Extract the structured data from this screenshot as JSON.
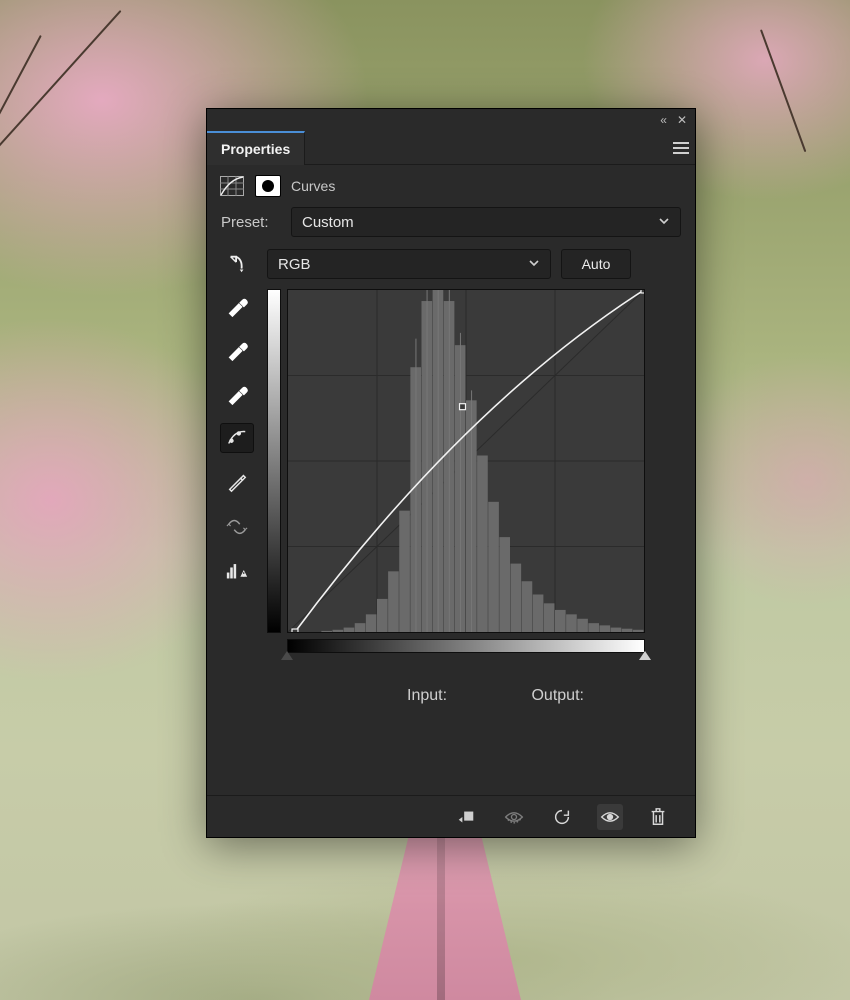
{
  "panel": {
    "title": "Properties",
    "adjustment_type": "Curves"
  },
  "preset": {
    "label": "Preset:",
    "value": "Custom"
  },
  "channel": {
    "value": "RGB",
    "auto_label": "Auto"
  },
  "io": {
    "input_label": "Input:",
    "output_label": "Output:",
    "input_value": "",
    "output_value": ""
  },
  "tools": [
    {
      "name": "hand-target-icon"
    },
    {
      "name": "eyedropper-black-icon"
    },
    {
      "name": "eyedropper-gray-icon"
    },
    {
      "name": "eyedropper-white-icon"
    },
    {
      "name": "curve-point-icon"
    },
    {
      "name": "pencil-icon"
    },
    {
      "name": "smooth-icon"
    },
    {
      "name": "clip-warning-icon"
    }
  ],
  "footer_icons": [
    {
      "name": "clip-to-layer-icon"
    },
    {
      "name": "view-previous-icon"
    },
    {
      "name": "reset-icon"
    },
    {
      "name": "visibility-icon"
    },
    {
      "name": "trash-icon"
    }
  ],
  "chart_data": {
    "type": "line",
    "title": "Curves — RGB",
    "xlabel": "Input",
    "ylabel": "Output",
    "xlim": [
      0,
      255
    ],
    "ylim": [
      0,
      255
    ],
    "series": [
      {
        "name": "curve",
        "points": [
          {
            "x": 5,
            "y": 0
          },
          {
            "x": 125,
            "y": 168
          },
          {
            "x": 255,
            "y": 255
          }
        ]
      }
    ],
    "histogram_note": "Mid-tone heavy histogram peaking around input 95–120, sparse shadows and highlights",
    "histogram_bins_0_255_step8": [
      0,
      0,
      0,
      1,
      2,
      4,
      8,
      16,
      30,
      55,
      110,
      240,
      300,
      310,
      300,
      260,
      210,
      160,
      118,
      86,
      62,
      46,
      34,
      26,
      20,
      16,
      12,
      8,
      6,
      4,
      3,
      2
    ]
  }
}
